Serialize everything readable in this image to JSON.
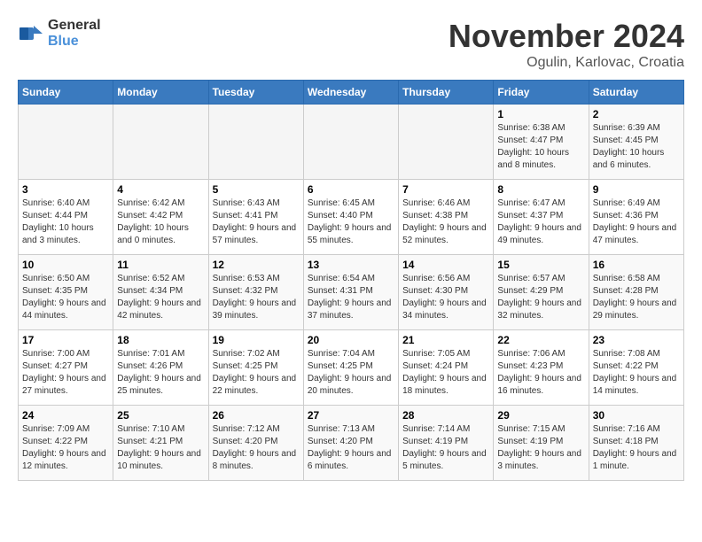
{
  "logo": {
    "general": "General",
    "blue": "Blue"
  },
  "title": "November 2024",
  "location": "Ogulin, Karlovac, Croatia",
  "days_header": [
    "Sunday",
    "Monday",
    "Tuesday",
    "Wednesday",
    "Thursday",
    "Friday",
    "Saturday"
  ],
  "weeks": [
    [
      {
        "day": "",
        "info": ""
      },
      {
        "day": "",
        "info": ""
      },
      {
        "day": "",
        "info": ""
      },
      {
        "day": "",
        "info": ""
      },
      {
        "day": "",
        "info": ""
      },
      {
        "day": "1",
        "info": "Sunrise: 6:38 AM\nSunset: 4:47 PM\nDaylight: 10 hours and 8 minutes."
      },
      {
        "day": "2",
        "info": "Sunrise: 6:39 AM\nSunset: 4:45 PM\nDaylight: 10 hours and 6 minutes."
      }
    ],
    [
      {
        "day": "3",
        "info": "Sunrise: 6:40 AM\nSunset: 4:44 PM\nDaylight: 10 hours and 3 minutes."
      },
      {
        "day": "4",
        "info": "Sunrise: 6:42 AM\nSunset: 4:42 PM\nDaylight: 10 hours and 0 minutes."
      },
      {
        "day": "5",
        "info": "Sunrise: 6:43 AM\nSunset: 4:41 PM\nDaylight: 9 hours and 57 minutes."
      },
      {
        "day": "6",
        "info": "Sunrise: 6:45 AM\nSunset: 4:40 PM\nDaylight: 9 hours and 55 minutes."
      },
      {
        "day": "7",
        "info": "Sunrise: 6:46 AM\nSunset: 4:38 PM\nDaylight: 9 hours and 52 minutes."
      },
      {
        "day": "8",
        "info": "Sunrise: 6:47 AM\nSunset: 4:37 PM\nDaylight: 9 hours and 49 minutes."
      },
      {
        "day": "9",
        "info": "Sunrise: 6:49 AM\nSunset: 4:36 PM\nDaylight: 9 hours and 47 minutes."
      }
    ],
    [
      {
        "day": "10",
        "info": "Sunrise: 6:50 AM\nSunset: 4:35 PM\nDaylight: 9 hours and 44 minutes."
      },
      {
        "day": "11",
        "info": "Sunrise: 6:52 AM\nSunset: 4:34 PM\nDaylight: 9 hours and 42 minutes."
      },
      {
        "day": "12",
        "info": "Sunrise: 6:53 AM\nSunset: 4:32 PM\nDaylight: 9 hours and 39 minutes."
      },
      {
        "day": "13",
        "info": "Sunrise: 6:54 AM\nSunset: 4:31 PM\nDaylight: 9 hours and 37 minutes."
      },
      {
        "day": "14",
        "info": "Sunrise: 6:56 AM\nSunset: 4:30 PM\nDaylight: 9 hours and 34 minutes."
      },
      {
        "day": "15",
        "info": "Sunrise: 6:57 AM\nSunset: 4:29 PM\nDaylight: 9 hours and 32 minutes."
      },
      {
        "day": "16",
        "info": "Sunrise: 6:58 AM\nSunset: 4:28 PM\nDaylight: 9 hours and 29 minutes."
      }
    ],
    [
      {
        "day": "17",
        "info": "Sunrise: 7:00 AM\nSunset: 4:27 PM\nDaylight: 9 hours and 27 minutes."
      },
      {
        "day": "18",
        "info": "Sunrise: 7:01 AM\nSunset: 4:26 PM\nDaylight: 9 hours and 25 minutes."
      },
      {
        "day": "19",
        "info": "Sunrise: 7:02 AM\nSunset: 4:25 PM\nDaylight: 9 hours and 22 minutes."
      },
      {
        "day": "20",
        "info": "Sunrise: 7:04 AM\nSunset: 4:25 PM\nDaylight: 9 hours and 20 minutes."
      },
      {
        "day": "21",
        "info": "Sunrise: 7:05 AM\nSunset: 4:24 PM\nDaylight: 9 hours and 18 minutes."
      },
      {
        "day": "22",
        "info": "Sunrise: 7:06 AM\nSunset: 4:23 PM\nDaylight: 9 hours and 16 minutes."
      },
      {
        "day": "23",
        "info": "Sunrise: 7:08 AM\nSunset: 4:22 PM\nDaylight: 9 hours and 14 minutes."
      }
    ],
    [
      {
        "day": "24",
        "info": "Sunrise: 7:09 AM\nSunset: 4:22 PM\nDaylight: 9 hours and 12 minutes."
      },
      {
        "day": "25",
        "info": "Sunrise: 7:10 AM\nSunset: 4:21 PM\nDaylight: 9 hours and 10 minutes."
      },
      {
        "day": "26",
        "info": "Sunrise: 7:12 AM\nSunset: 4:20 PM\nDaylight: 9 hours and 8 minutes."
      },
      {
        "day": "27",
        "info": "Sunrise: 7:13 AM\nSunset: 4:20 PM\nDaylight: 9 hours and 6 minutes."
      },
      {
        "day": "28",
        "info": "Sunrise: 7:14 AM\nSunset: 4:19 PM\nDaylight: 9 hours and 5 minutes."
      },
      {
        "day": "29",
        "info": "Sunrise: 7:15 AM\nSunset: 4:19 PM\nDaylight: 9 hours and 3 minutes."
      },
      {
        "day": "30",
        "info": "Sunrise: 7:16 AM\nSunset: 4:18 PM\nDaylight: 9 hours and 1 minute."
      }
    ]
  ]
}
